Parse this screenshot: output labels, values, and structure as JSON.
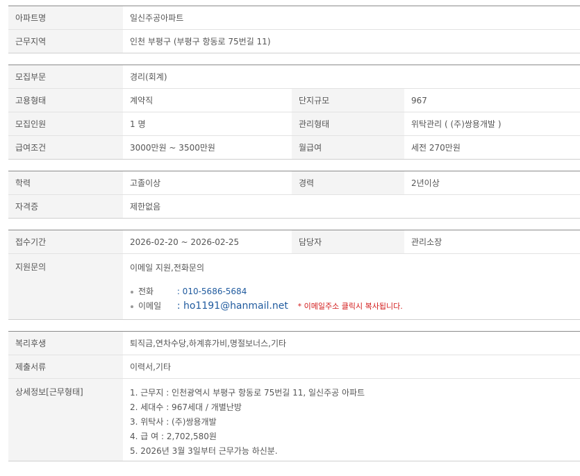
{
  "section1": [
    {
      "label": "아파트명",
      "value": "일신주공아파트"
    },
    {
      "label": "근무지역",
      "value": "인천 부평구 (부평구 항동로 75번길 11)"
    }
  ],
  "section2": {
    "dept": {
      "label": "모집부문",
      "value": "경리(회계)"
    },
    "employment": {
      "label": "고용형태",
      "value": "계약직"
    },
    "complex_size": {
      "label": "단지규모",
      "value": "967"
    },
    "headcount": {
      "label": "모집인원",
      "value": "1 명"
    },
    "mgmt_type": {
      "label": "관리형태",
      "value": "위탁관리 ( (주)쌍용개발 )"
    },
    "salary_cond": {
      "label": "급여조건",
      "value": "3000만원 ~ 3500만원"
    },
    "monthly": {
      "label": "월급여",
      "value": "세전 270만원"
    }
  },
  "section3": {
    "edu": {
      "label": "학력",
      "value": "고졸이상"
    },
    "career": {
      "label": "경력",
      "value": "2년이상"
    },
    "cert": {
      "label": "자격증",
      "value": "제한없음"
    }
  },
  "section4": {
    "period": {
      "label": "접수기간",
      "value": "2026-02-20 ~ 2026-02-25"
    },
    "manager": {
      "label": "담당자",
      "value": "관리소장"
    },
    "inquiry": {
      "label": "지원문의",
      "method": "이메일 지원,전화문의",
      "phone_label": "전화",
      "phone": ": 010-5686-5684",
      "email_label": "이메일",
      "email": ": ho1191@hanmail.net",
      "email_note": "* 이메일주소 클릭시 복사됩니다."
    }
  },
  "section5": {
    "welfare": {
      "label": "복리후생",
      "value": "퇴직금,연차수당,하계휴가비,명절보너스,기타"
    },
    "documents": {
      "label": "제출서류",
      "value": "이력서,기타"
    },
    "detail": {
      "label": "상세정보[근무형태]",
      "lines": [
        "1. 근무지 : 인천광역시 부평구 항동로 75번길 11, 일신주공 아파트",
        "2. 세대수 : 967세대 / 개별난방",
        "3. 위탁사 : (주)쌍용개발",
        "4. 급 여 : 2,702,580원",
        "5. 2026년 3월 3일부터 근무가능 하신분."
      ]
    }
  }
}
